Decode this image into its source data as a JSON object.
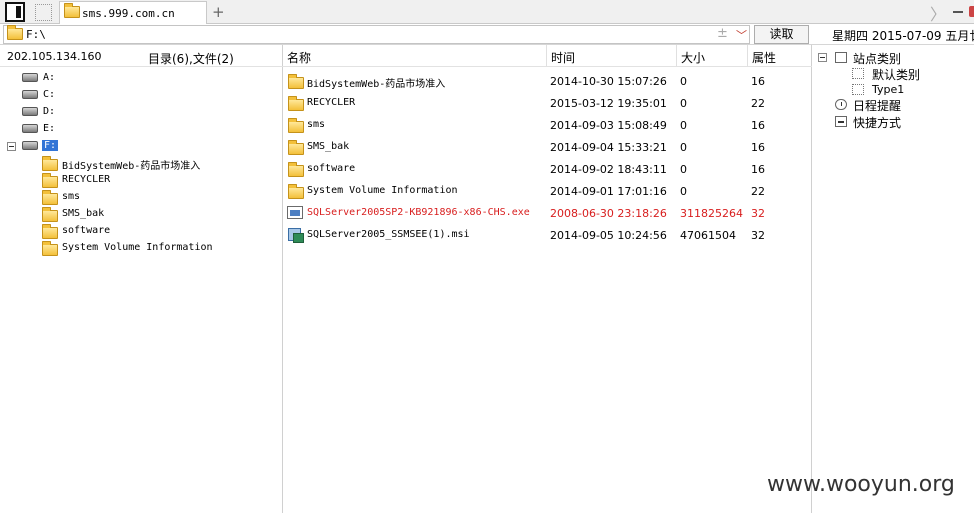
{
  "tab": {
    "title": "sms.999.com.cn",
    "add_label": "+"
  },
  "window": {
    "nav_forward": "〉"
  },
  "address": {
    "path": "F:\\",
    "plus": "±",
    "caret": "﹀",
    "read_button": "读取"
  },
  "date": "星期四 2015-07-09 五月廿",
  "left_panel": {
    "ip": "202.105.134.160",
    "dir_count": "目录(6),文件(2)",
    "drives": [
      "A:",
      "C:",
      "D:",
      "E:"
    ],
    "selected_drive": "F:",
    "folders": [
      "BidSystemWeb-药品市场准入",
      "RECYCLER",
      "sms",
      "SMS_bak",
      "software",
      "System Volume Information"
    ]
  },
  "file_list": {
    "headers": {
      "name": "名称",
      "time": "时间",
      "size": "大小",
      "attr": "属性"
    },
    "rows": [
      {
        "name": "BidSystemWeb-药品市场准入",
        "time": "2014-10-30 15:07:26",
        "size": "0",
        "attr": "16",
        "kind": "folder-icon"
      },
      {
        "name": "RECYCLER",
        "time": "2015-03-12 19:35:01",
        "size": "0",
        "attr": "22",
        "kind": "folder-icon"
      },
      {
        "name": "sms",
        "time": "2014-09-03 15:08:49",
        "size": "0",
        "attr": "16",
        "kind": "folder-icon"
      },
      {
        "name": "SMS_bak",
        "time": "2014-09-04 15:33:21",
        "size": "0",
        "attr": "16",
        "kind": "folder-icon"
      },
      {
        "name": "software",
        "time": "2014-09-02 18:43:11",
        "size": "0",
        "attr": "16",
        "kind": "folder-icon"
      },
      {
        "name": "System Volume Information",
        "time": "2014-09-01 17:01:16",
        "size": "0",
        "attr": "22",
        "kind": "folder-icon"
      },
      {
        "name": "SQLServer2005SP2-KB921896-x86-CHS.exe",
        "time": "2008-06-30 23:18:26",
        "size": "311825264",
        "attr": "32",
        "kind": "exe-icon",
        "highlight_color": "#d81e1e"
      },
      {
        "name": "SQLServer2005_SSMSEE(1).msi",
        "time": "2014-09-05 10:24:56",
        "size": "47061504",
        "attr": "32",
        "kind": "msi-icon"
      }
    ]
  },
  "right_panel": {
    "site_category": "站点类别",
    "default_category": "默认类别",
    "type1": "Type1",
    "schedule": "日程提醒",
    "shortcut": "快捷方式"
  },
  "watermark": "www.wooyun.org"
}
